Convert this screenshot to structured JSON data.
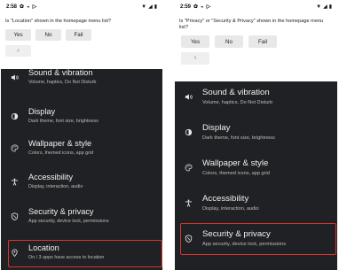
{
  "left": {
    "status": {
      "time": "2:58"
    },
    "question": "Is \"Location\" shown in the homepage menu list?",
    "buttons": [
      "Yes",
      "No",
      "Fail"
    ],
    "hash": "#",
    "items": [
      {
        "title": "Sound & vibration",
        "sub": "Volume, haptics, Do Not Disturb",
        "icon": "speaker-icon"
      },
      {
        "title": "Display",
        "sub": "Dark theme, font size, brightness",
        "icon": "brightness-icon"
      },
      {
        "title": "Wallpaper & style",
        "sub": "Colors, themed icons, app grid",
        "icon": "palette-icon"
      },
      {
        "title": "Accessibility",
        "sub": "Display, interaction, audio",
        "icon": "accessibility-icon"
      },
      {
        "title": "Security & privacy",
        "sub": "App security, device lock, permissions",
        "icon": "shield-icon"
      },
      {
        "title": "Location",
        "sub": "On / 3 apps have access to location",
        "icon": "location-pin-icon"
      }
    ]
  },
  "right": {
    "status": {
      "time": "2:59"
    },
    "question": "Is \"Privacy\" or \"Security & Privacy\" shown in the homepage menu list?",
    "buttons": [
      "Yes",
      "No",
      "Fail"
    ],
    "hash": "#",
    "items": [
      {
        "title": "Sound & vibration",
        "sub": "Volume, haptics, Do Not Disturb",
        "icon": "speaker-icon"
      },
      {
        "title": "Display",
        "sub": "Dark theme, font size, brightness",
        "icon": "brightness-icon"
      },
      {
        "title": "Wallpaper & style",
        "sub": "Colors, themed icons, app grid",
        "icon": "palette-icon"
      },
      {
        "title": "Accessibility",
        "sub": "Display, interaction, audio",
        "icon": "accessibility-icon"
      },
      {
        "title": "Security & privacy",
        "sub": "App security, device lock, permissions",
        "icon": "shield-icon"
      }
    ]
  },
  "colors": {
    "highlight": "#d9342b",
    "background": "#202124",
    "panel": "#ffffff"
  }
}
